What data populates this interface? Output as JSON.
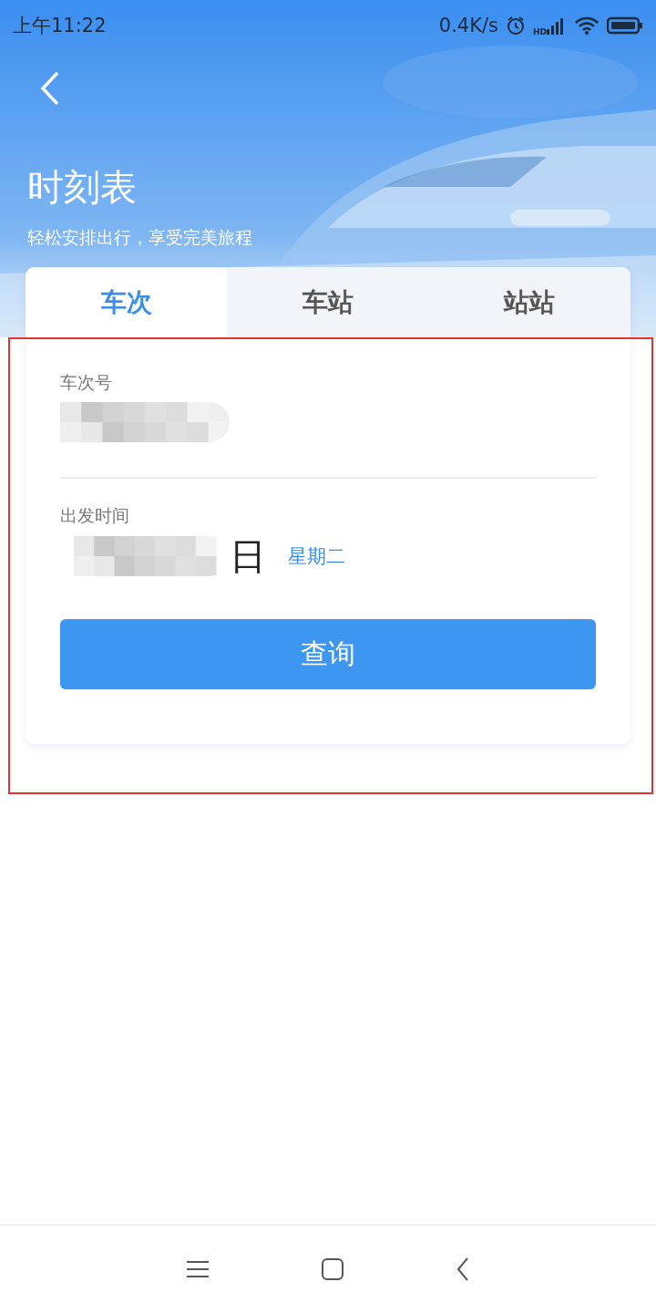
{
  "status_bar": {
    "time": "上午11:22",
    "speed": "0.4K/s",
    "signal_label": "HD"
  },
  "header": {
    "title": "时刻表",
    "subtitle": "轻松安排出行，享受完美旅程"
  },
  "tabs": [
    {
      "label": "车次",
      "selected": true
    },
    {
      "label": "车站",
      "selected": false
    },
    {
      "label": "站站",
      "selected": false
    }
  ],
  "form": {
    "train_number": {
      "label": "车次号"
    },
    "departure": {
      "label": "出发时间",
      "value": "日",
      "weekday": "星期二"
    },
    "submit": "查询"
  }
}
